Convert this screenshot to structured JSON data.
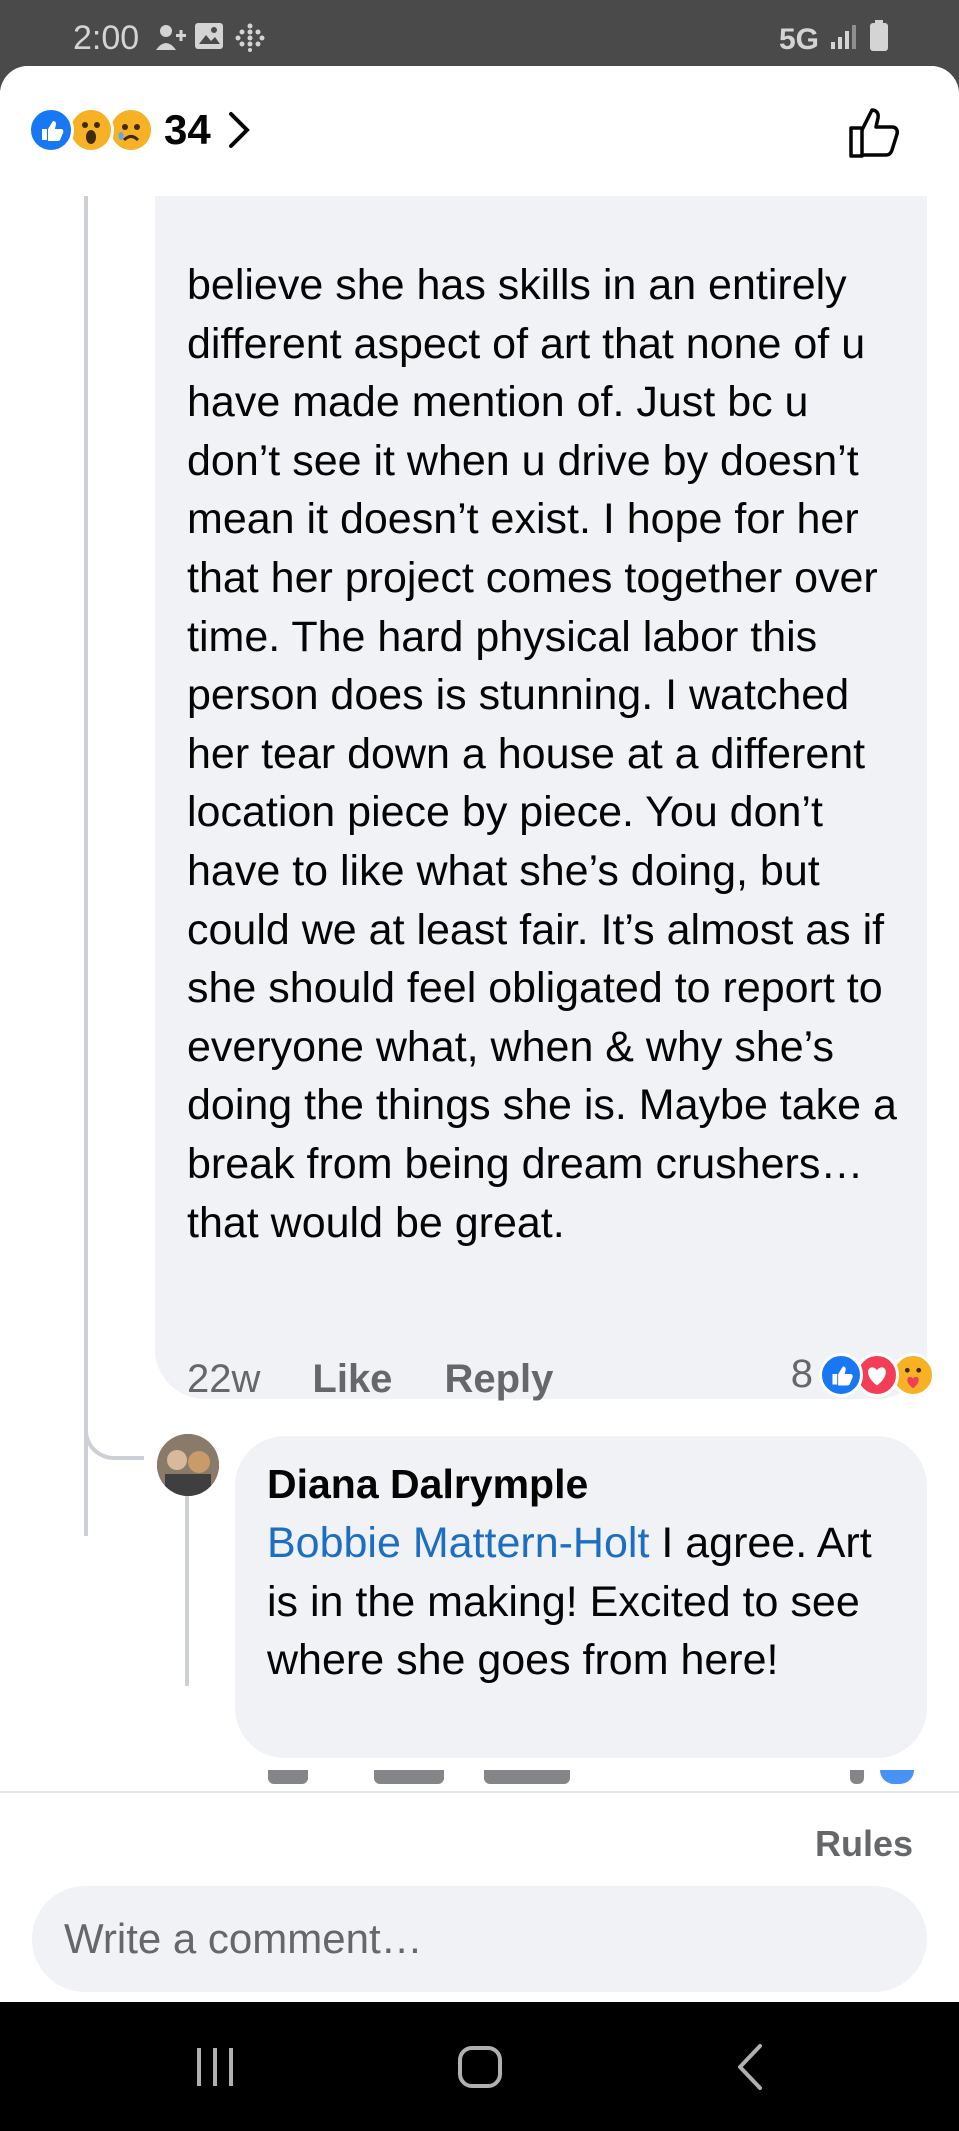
{
  "status_bar": {
    "time": "2:00",
    "network": "5G",
    "icons": [
      "person-add-icon",
      "image-icon",
      "dots-grid-icon",
      "signal-icon",
      "battery-icon"
    ]
  },
  "header": {
    "reaction_count": "34",
    "reaction_icons": [
      "like-reaction-icon",
      "wow-reaction-icon",
      "sad-reaction-icon"
    ]
  },
  "main_comment": {
    "text": "believe she has skills in an entirely different aspect of art that none of u have made mention of. Just bc u don’t see it when u drive by doesn’t mean it doesn’t exist.  I hope for her that her project comes together over time.  The hard physical labor this person does is stunning.  I watched her tear down a house at a different location piece by piece.  You don’t have to like what she’s doing, but could we at least fair.  It’s almost as if she should feel obligated to report to everyone what, when & why she’s doing the things she is.  Maybe take a break from being dream crushers… that would be great.",
    "time": "22w",
    "like_label": "Like",
    "reply_label": "Reply",
    "reaction_count": "8"
  },
  "reply_comment": {
    "author": "Diana Dalrymple",
    "mention": "Bobbie Mattern-Holt",
    "text": " I agree. Art is in the making! Excited to see where she goes from here!"
  },
  "composer": {
    "rules_label": "Rules",
    "placeholder": "Write a comment…"
  },
  "colors": {
    "accent": "#1877f2",
    "mention": "#1b6ec2",
    "bubble": "#f0f2f5",
    "meta_text": "#65676b"
  }
}
